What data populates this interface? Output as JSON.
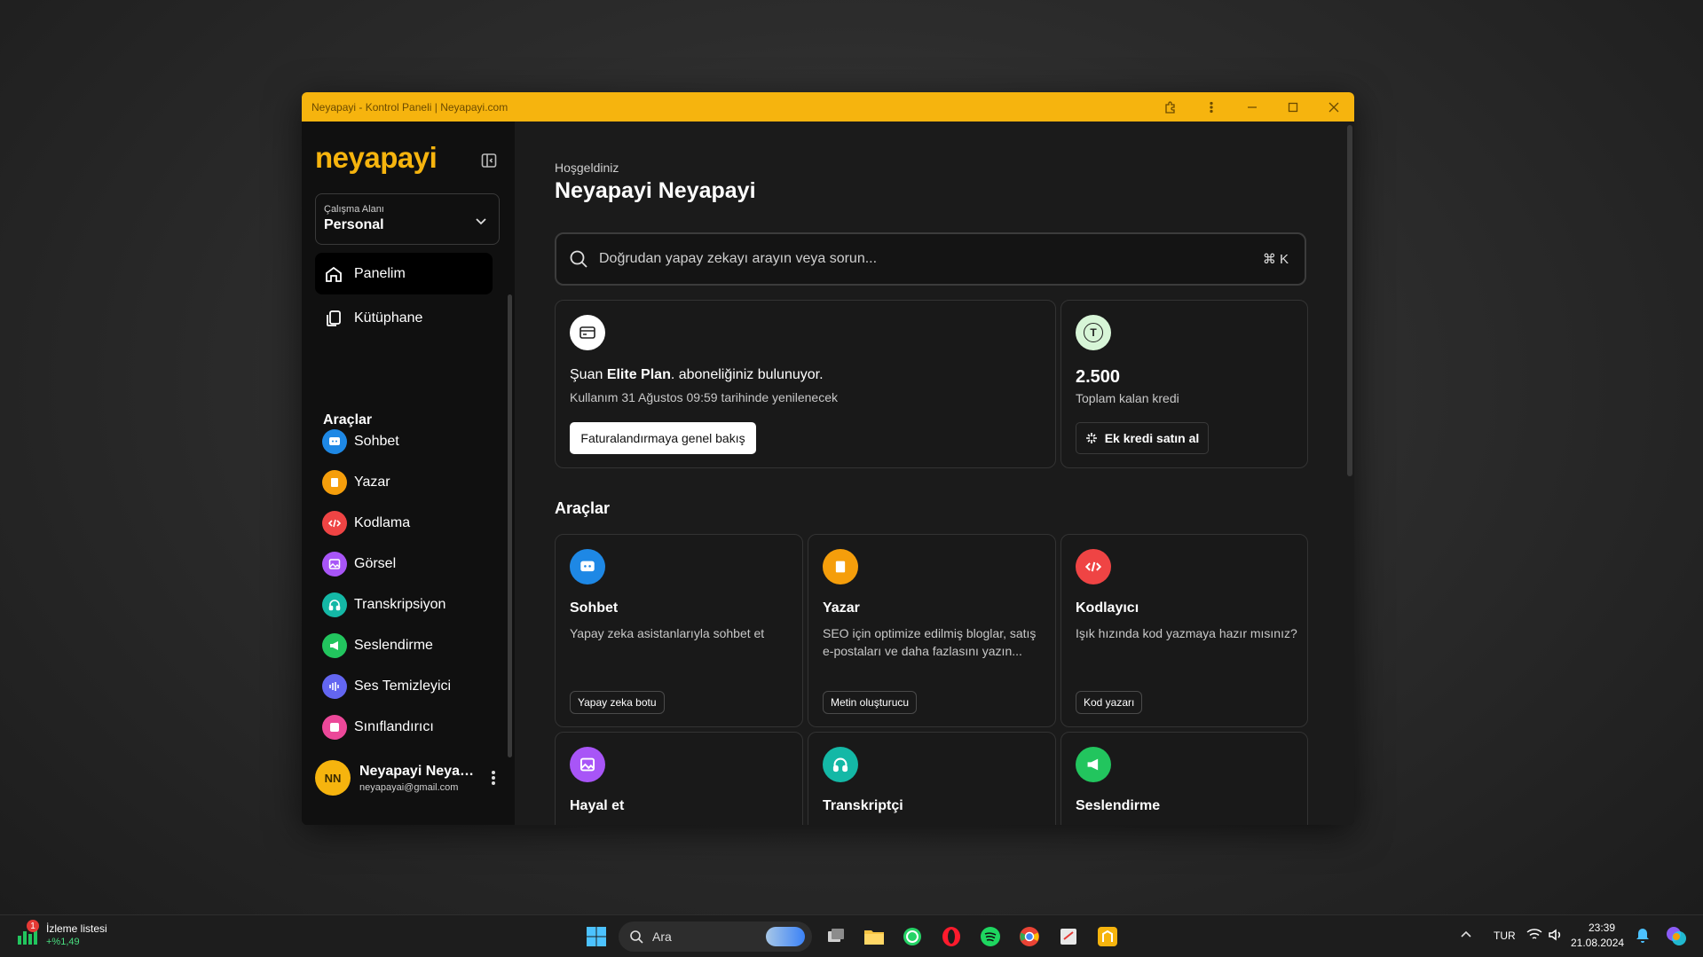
{
  "window": {
    "title": "Neyapayi - Kontrol Paneli | Neyapayi.com"
  },
  "sidebar": {
    "logo": "neyapayi",
    "workspace": {
      "label": "Çalışma Alanı",
      "value": "Personal"
    },
    "nav": [
      {
        "label": "Panelim",
        "icon": "home-icon"
      },
      {
        "label": "Kütüphane",
        "icon": "library-icon"
      }
    ],
    "tools_heading": "Araçlar",
    "tools": [
      {
        "label": "Sohbet",
        "color": "#1e88e5"
      },
      {
        "label": "Yazar",
        "color": "#f59e0b"
      },
      {
        "label": "Kodlama",
        "color": "#ef4444"
      },
      {
        "label": "Görsel",
        "color": "#a855f7"
      },
      {
        "label": "Transkripsiyon",
        "color": "#14b8a6"
      },
      {
        "label": "Seslendirme",
        "color": "#22c55e"
      },
      {
        "label": "Ses Temizleyici",
        "color": "#6366f1"
      },
      {
        "label": "Sınıflandırıcı",
        "color": "#ec4899"
      }
    ],
    "user": {
      "initials": "NN",
      "name": "Neyapayi Neyapayi",
      "email": "neyapayai@gmail.com"
    }
  },
  "main": {
    "greeting": "Hoşgeldiniz",
    "user_name": "Neyapayi Neyapayi",
    "search": {
      "placeholder": "Doğrudan yapay zekayı arayın veya sorun...",
      "shortcut": "⌘ K"
    },
    "plan_card": {
      "prefix": "Şuan ",
      "plan": "Elite Plan",
      "suffix": ". aboneliğiniz bulunuyor.",
      "renewal": "Kullanım 31 Ağustos 09:59 tarihinde yenilenecek",
      "button": "Faturalandırmaya genel bakış"
    },
    "credit_card": {
      "icon_letter": "T",
      "amount": "2.500",
      "label": "Toplam kalan kredi",
      "button": "Ek kredi satın al"
    },
    "tools_heading": "Araçlar",
    "tool_cards": [
      {
        "title": "Sohbet",
        "desc": "Yapay zeka asistanlarıyla sohbet et",
        "tag": "Yapay zeka botu",
        "color": "#1e88e5"
      },
      {
        "title": "Yazar",
        "desc": "SEO için optimize edilmiş bloglar, satış e-postaları ve daha fazlasını yazın...",
        "tag": "Metin oluşturucu",
        "color": "#f59e0b"
      },
      {
        "title": "Kodlayıcı",
        "desc": "Işık hızında kod yazmaya hazır mısınız?",
        "tag": "Kod yazarı",
        "color": "#ef4444"
      },
      {
        "title": "Hayal et",
        "color": "#a855f7"
      },
      {
        "title": "Transkriptçi",
        "color": "#14b8a6"
      },
      {
        "title": "Seslendirme",
        "color": "#22c55e"
      }
    ]
  },
  "taskbar": {
    "widget": {
      "title": "İzleme listesi",
      "value": "+%1,49",
      "badge": "1"
    },
    "search": "Ara",
    "lang": "TUR",
    "time": "23:39",
    "date": "21.08.2024"
  }
}
